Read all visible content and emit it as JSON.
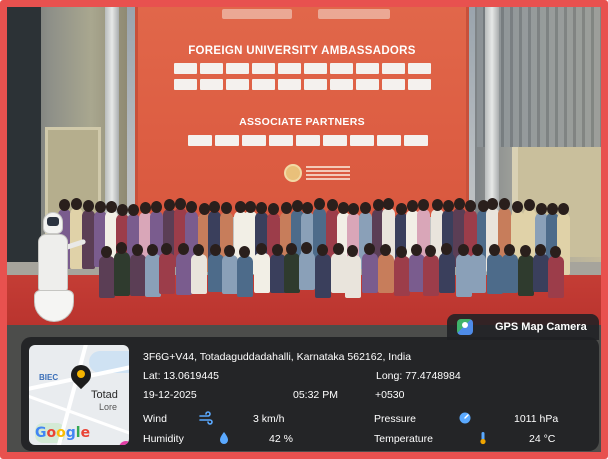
{
  "photo": {
    "banner": {
      "title": "FOREIGN UNIVERSITY AMBASSADORS",
      "subtitle": "ASSOCIATE PARTNERS"
    }
  },
  "gps_overlay": {
    "app_name": "GPS Map Camera",
    "address": "3F6G+V44, Totadaguddadahalli, Karnataka 562162, India",
    "lat": "Lat: 13.0619445",
    "long": "Long: 77.4748984",
    "date": "19-12-2025",
    "time": "05:32 PM",
    "timezone": "+0530",
    "wind_label": "Wind",
    "wind_value": "3 km/h",
    "pressure_label": "Pressure",
    "pressure_value": "1011 hPa",
    "humidity_label": "Humidity",
    "humidity_value": "42 %",
    "temperature_label": "Temperature",
    "temperature_value": "24 °C",
    "map": {
      "label_1": "BIEC",
      "label_2": "Totad",
      "label_3": "Lore",
      "logo_letters": [
        "G",
        "o",
        "o",
        "g",
        "l",
        "e"
      ],
      "logo_colors": [
        "#4285F4",
        "#EA4335",
        "#FBBC05",
        "#4285F4",
        "#34A853",
        "#EA4335"
      ]
    },
    "icons": {
      "app": "gps-map-camera-icon",
      "pin": "map-pin-icon",
      "wind": "wind-icon",
      "pressure": "pressure-icon",
      "humidity": "humidity-icon",
      "temperature": "thermometer-icon"
    }
  },
  "colors": {
    "frame": "#e8514f",
    "banner": "#dd5e43",
    "carpet": "#c43d35",
    "overlay": "#202124"
  }
}
